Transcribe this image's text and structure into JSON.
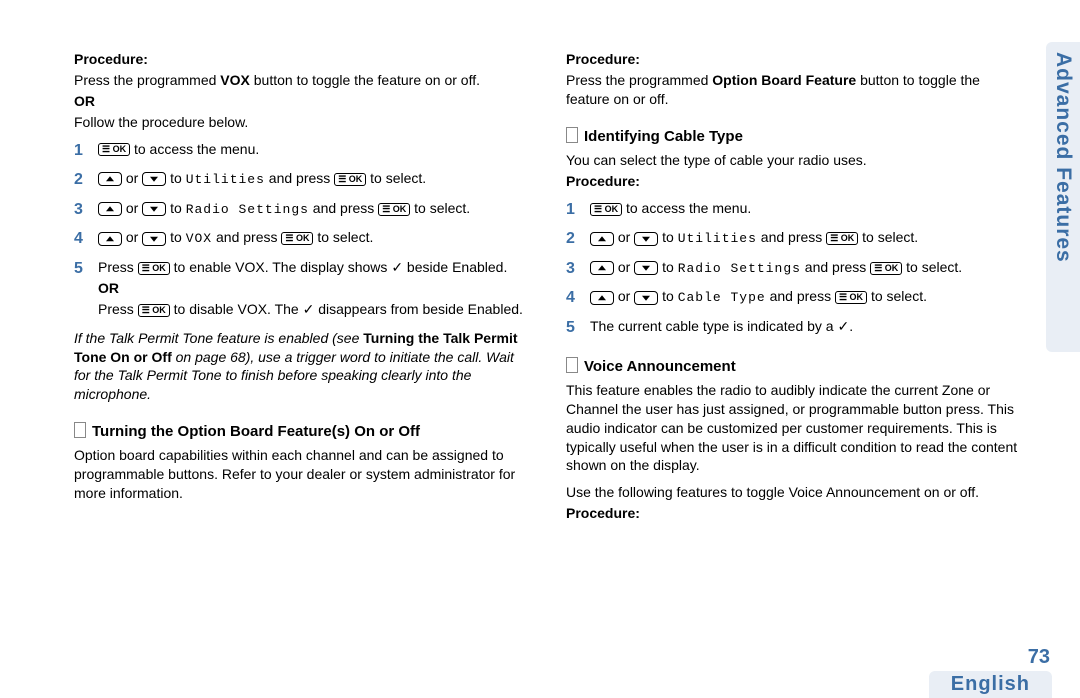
{
  "sideTab": "Advanced Features",
  "pageNum": "73",
  "language": "English",
  "left": {
    "procLabel1": "Procedure:",
    "intro1a": "Press the programmed ",
    "intro1b": "VOX",
    "intro1c": " button to toggle the feature on or off.",
    "or1": "OR",
    "intro2": "Follow the procedure below.",
    "step1": " to access the menu.",
    "step2a": " or ",
    "step2b": " to ",
    "step2target": "Utilities",
    "step2c": " and press ",
    "step2d": " to select.",
    "step3target": "Radio Settings",
    "step4target": "VOX",
    "step5a": "Press ",
    "step5b": " to enable VOX. The display shows ",
    "step5c": " beside Enabled.",
    "or2": "OR",
    "step5d": "Press ",
    "step5e": " to disable VOX. The ",
    "step5f": " disappears from beside Enabled.",
    "noteA": "If the Talk Permit Tone feature is enabled (see ",
    "noteB": "Turning the Talk Permit Tone On or Off",
    "noteC": " on page 68), use a trigger word to initiate the call. Wait for the Talk Permit Tone to finish before speaking clearly into the microphone.",
    "sectionH1": "Turning the Option Board Feature(s) On or Off",
    "sectionP1": "Option board capabilities within each channel and can be assigned to programmable buttons. Refer to your dealer or system administrator for more information."
  },
  "right": {
    "procLabel1": "Procedure:",
    "intro1a": "Press the programmed ",
    "intro1b": "Option Board Feature",
    "intro1c": " button to toggle the feature on or off.",
    "sectionH1": "Identifying Cable Type",
    "sectionP1": "You can select the type of cable your radio uses.",
    "procLabel2": "Procedure:",
    "step1": " to access the menu.",
    "step2target": "Utilities",
    "step3target": "Radio Settings",
    "step4target": "Cable Type",
    "step5": "The current cable type is indicated by a ",
    "sectionH2": "Voice Announcement",
    "sectionP2": "This feature enables the radio to audibly indicate the current Zone or Channel the user has just assigned, or programmable button press. This audio indicator can be customized per customer requirements. This is typically useful when the user is in a difficult condition to read the content shown on the display.",
    "sectionP3": "Use the following features to toggle Voice Announcement on or off.",
    "procLabel3": "Procedure:"
  },
  "glyph": {
    "ok": "☰ OK",
    "check": "✓",
    "period": "."
  }
}
